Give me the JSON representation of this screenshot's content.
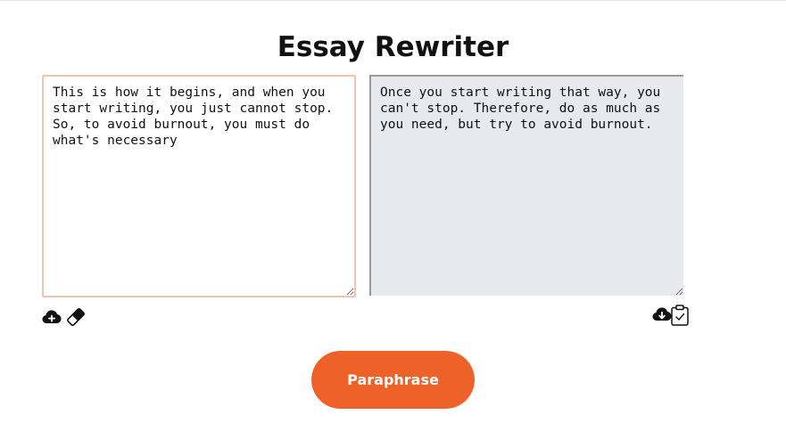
{
  "page": {
    "title": "Essay Rewriter"
  },
  "input": {
    "value": "This is how it begins, and when you start writing, you just cannot stop. So, to avoid burnout, you must do what's necessary"
  },
  "output": {
    "value": "Once you start writing that way, you can't stop. Therefore, do as much as you need, but try to avoid burnout."
  },
  "actions": {
    "paraphrase_label": "Paraphrase"
  },
  "icons": {
    "upload": "cloud-upload-icon",
    "clear": "eraser-icon",
    "download": "cloud-download-icon",
    "copy": "clipboard-check-icon"
  },
  "colors": {
    "accent": "#ee6129",
    "input_border": "#f1c4ad",
    "output_background": "#e8e9ee"
  }
}
